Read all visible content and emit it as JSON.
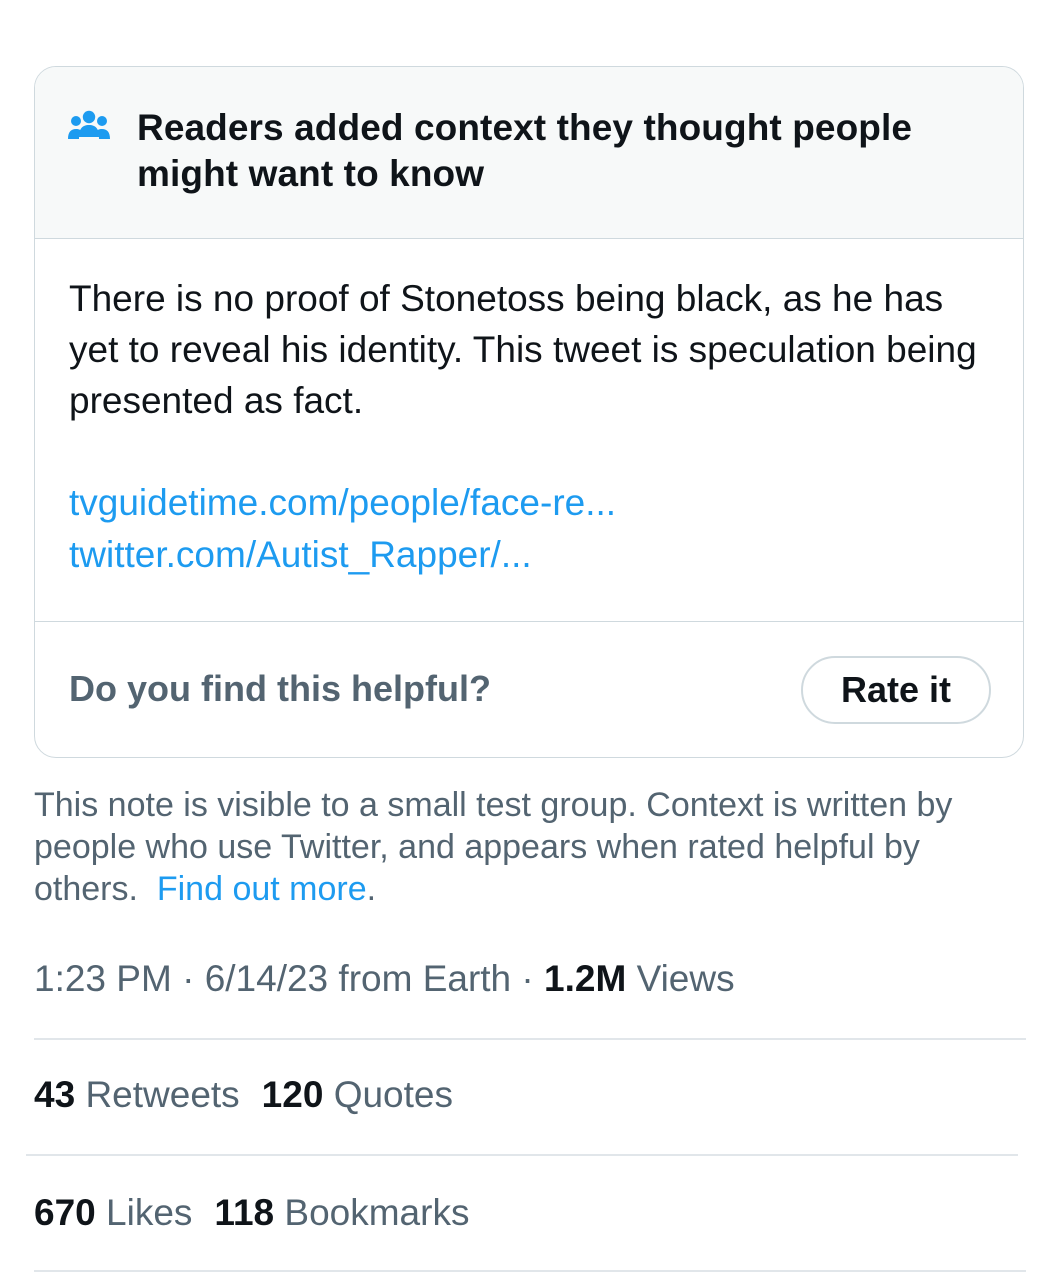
{
  "note": {
    "header_title": "Readers added context they thought people might want to know",
    "header_icon": "people-group-icon",
    "body": "There is no proof of Stonetoss being black, as he has yet to reveal his identity. This tweet is speculation being presented as fact.",
    "links": [
      "tvguidetime.com/people/face-re...",
      "twitter.com/Autist_Rapper/..."
    ],
    "helpful_question": "Do you find this helpful?",
    "rate_button_label": "Rate it"
  },
  "visibility": {
    "text": "This note is visible to a small test group. Context is written by people who use Twitter, and appears when rated helpful by others.",
    "find_out_more": "Find out more",
    "trailing": "."
  },
  "meta": {
    "time": "1:23 PM",
    "sep1": " · ",
    "date": "6/14/23",
    "source": " from Earth",
    "sep2": " · ",
    "views_count": "1.2M",
    "views_label": " Views"
  },
  "stats_row1": [
    {
      "count": "43",
      "label": "Retweets"
    },
    {
      "count": "120",
      "label": "Quotes"
    }
  ],
  "stats_row2": [
    {
      "count": "670",
      "label": "Likes"
    },
    {
      "count": "118",
      "label": "Bookmarks"
    }
  ],
  "colors": {
    "accent": "#1d9bf0",
    "text_primary": "#0f1419",
    "text_secondary": "#536471",
    "border": "#cfd9de",
    "header_bg": "#f7f9f9"
  }
}
